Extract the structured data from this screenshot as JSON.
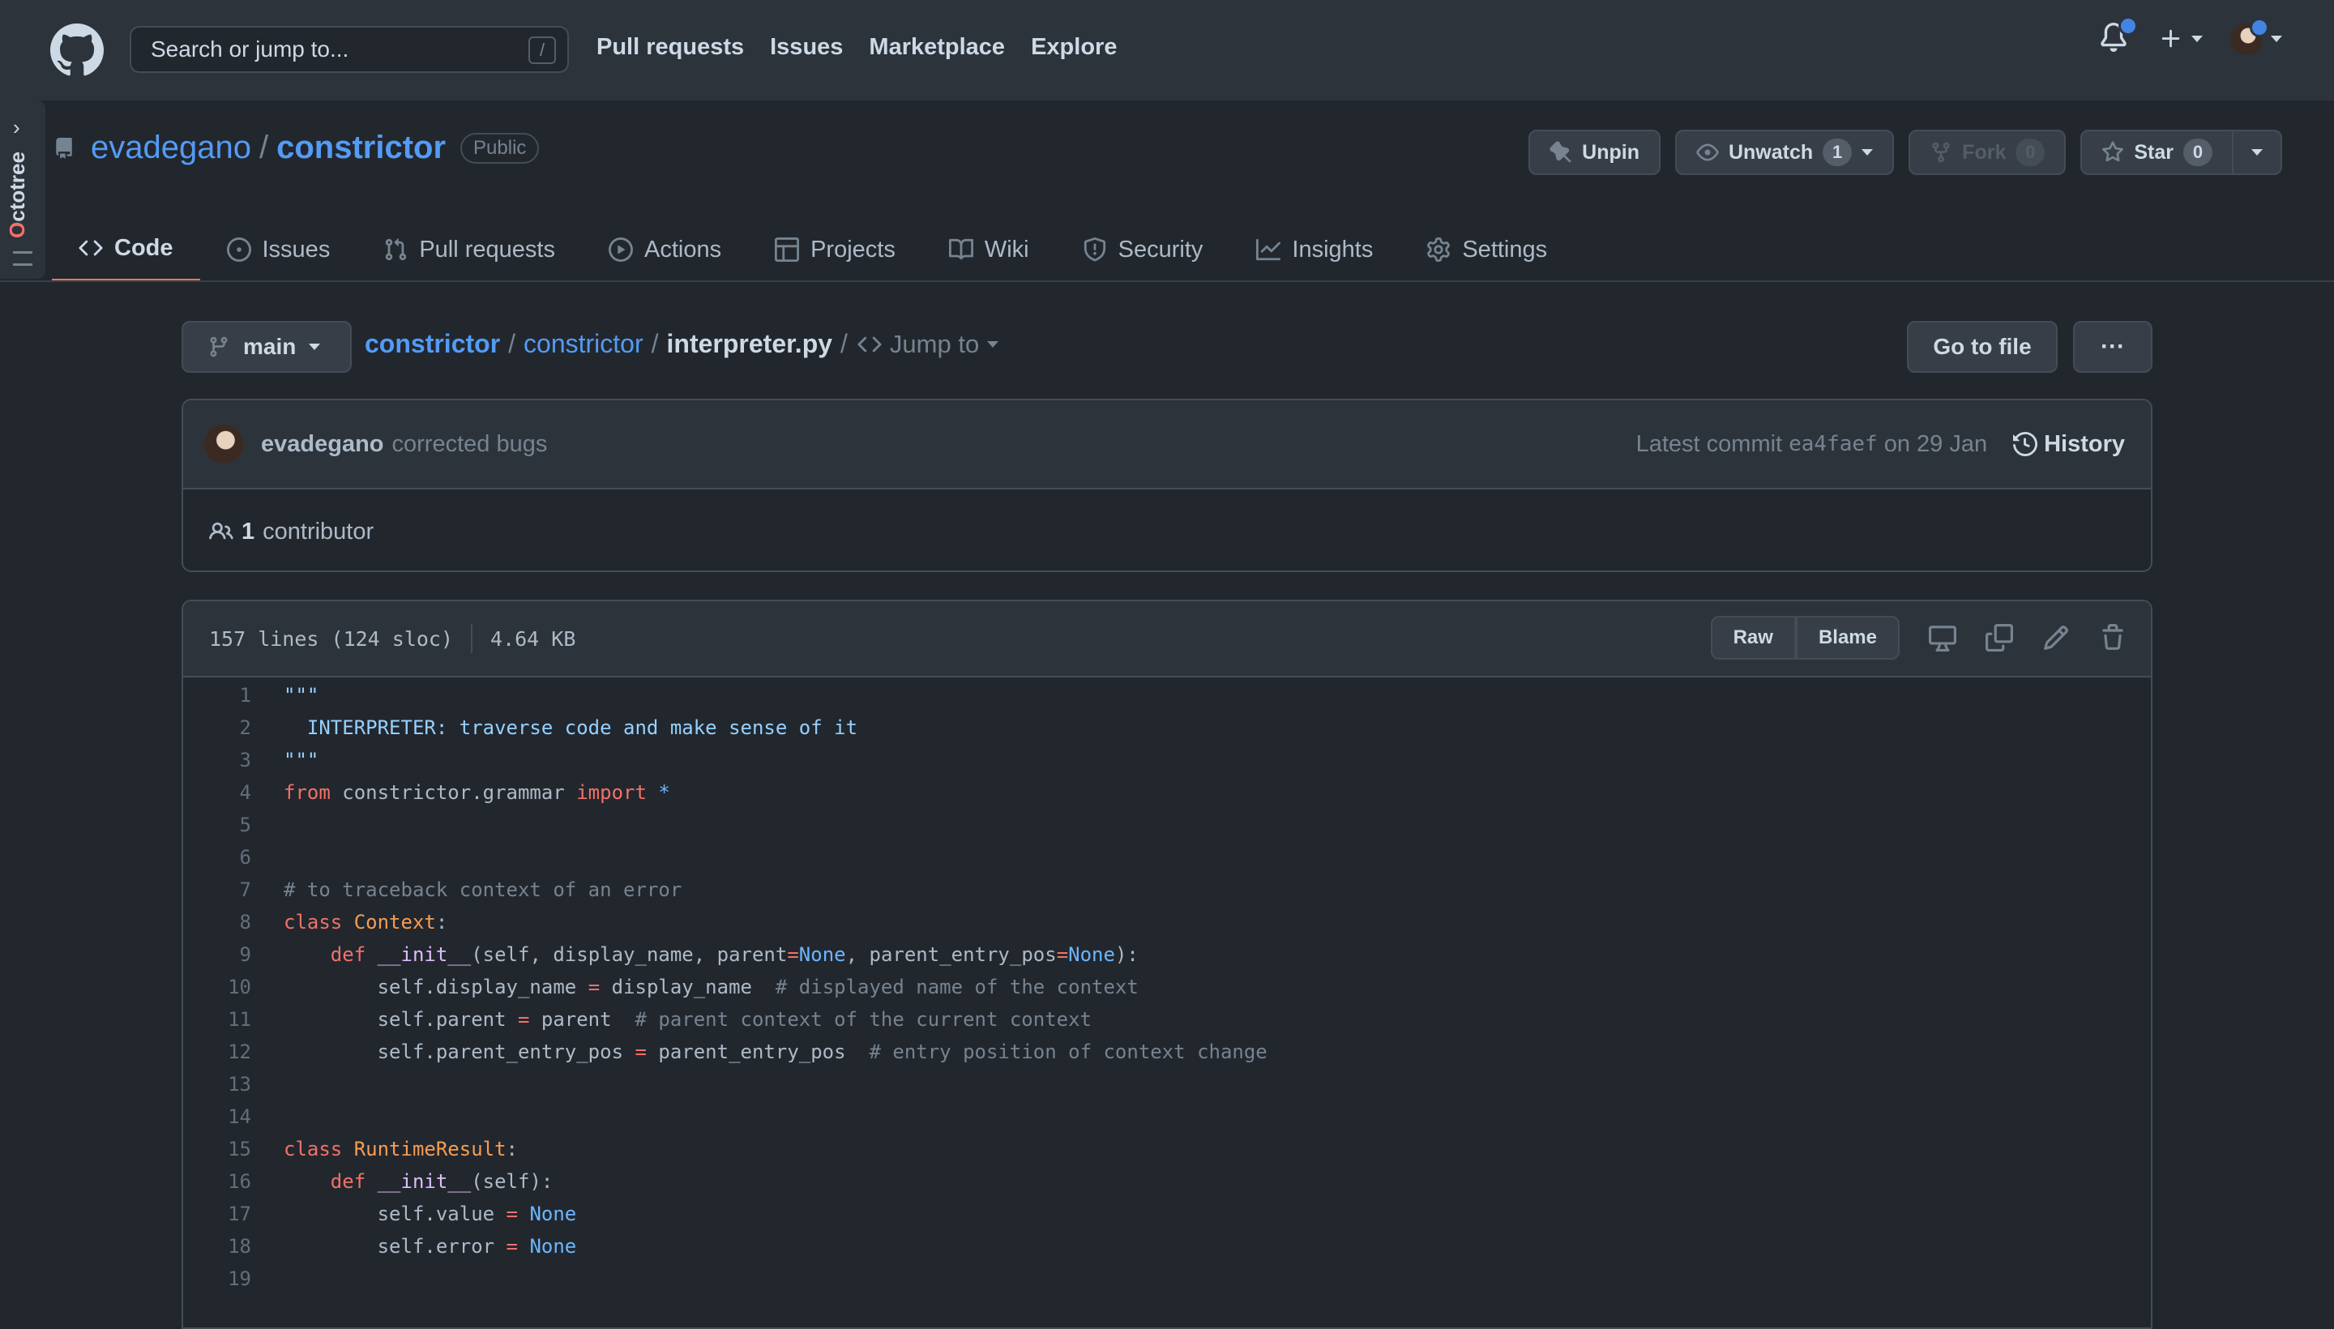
{
  "header": {
    "search_placeholder": "Search or jump to...",
    "search_shortcut": "/",
    "nav": [
      "Pull requests",
      "Issues",
      "Marketplace",
      "Explore"
    ]
  },
  "octotree": {
    "label_first": "O",
    "label_rest": "ctotree"
  },
  "repo": {
    "owner": "evadegano",
    "separator": "/",
    "name": "constrictor",
    "visibility": "Public",
    "unpin_label": "Unpin",
    "watch_label": "Unwatch",
    "watch_count": "1",
    "fork_label": "Fork",
    "fork_count": "0",
    "star_label": "Star",
    "star_count": "0"
  },
  "tabs": [
    {
      "label": "Code",
      "icon": "code-icon"
    },
    {
      "label": "Issues",
      "icon": "issue-icon"
    },
    {
      "label": "Pull requests",
      "icon": "pull-request-icon"
    },
    {
      "label": "Actions",
      "icon": "play-icon"
    },
    {
      "label": "Projects",
      "icon": "table-icon"
    },
    {
      "label": "Wiki",
      "icon": "book-icon"
    },
    {
      "label": "Security",
      "icon": "shield-icon"
    },
    {
      "label": "Insights",
      "icon": "graph-icon"
    },
    {
      "label": "Settings",
      "icon": "gear-icon"
    }
  ],
  "filenav": {
    "branch": "main",
    "crumb_root": "constrictor",
    "crumb_dir": "constrictor",
    "crumb_file": "interpreter.py",
    "crumb_sep": "/",
    "jump_label": "Jump to",
    "goto_label": "Go to file",
    "more_label": "···"
  },
  "commit": {
    "author": "evadegano",
    "message": "corrected bugs",
    "latest_label": "Latest commit",
    "sha": "ea4faef",
    "date": "on 29 Jan",
    "history_label": "History",
    "contributors_count": "1",
    "contributors_label": "contributor"
  },
  "file": {
    "lines_info": "157 lines (124 sloc)",
    "size": "4.64 KB",
    "raw_label": "Raw",
    "blame_label": "Blame"
  },
  "code_lines": [
    {
      "n": "1",
      "t": [
        [
          "str",
          "\"\"\""
        ]
      ]
    },
    {
      "n": "2",
      "t": [
        [
          "str",
          "  INTERPRETER: traverse code and make sense of it"
        ]
      ]
    },
    {
      "n": "3",
      "t": [
        [
          "str",
          "\"\"\""
        ]
      ]
    },
    {
      "n": "4",
      "t": [
        [
          "kw",
          "from"
        ],
        [
          "src",
          " constrictor.grammar "
        ],
        [
          "kw",
          "import"
        ],
        [
          "src",
          " "
        ],
        [
          "con",
          "*"
        ]
      ]
    },
    {
      "n": "5",
      "t": []
    },
    {
      "n": "6",
      "t": []
    },
    {
      "n": "7",
      "t": [
        [
          "cmt",
          "# to traceback context of an error"
        ]
      ]
    },
    {
      "n": "8",
      "t": [
        [
          "kw",
          "class"
        ],
        [
          "src",
          " "
        ],
        [
          "ent",
          "Context"
        ],
        [
          "src",
          ":"
        ]
      ]
    },
    {
      "n": "9",
      "t": [
        [
          "src",
          "    "
        ],
        [
          "kw",
          "def"
        ],
        [
          "src",
          " "
        ],
        [
          "fn",
          "__init__"
        ],
        [
          "src",
          "(self, display_name, parent"
        ],
        [
          "kw",
          "="
        ],
        [
          "con",
          "None"
        ],
        [
          "src",
          ", parent_entry_pos"
        ],
        [
          "kw",
          "="
        ],
        [
          "con",
          "None"
        ],
        [
          "src",
          "):"
        ]
      ]
    },
    {
      "n": "10",
      "t": [
        [
          "src",
          "        self.display_name "
        ],
        [
          "kw",
          "="
        ],
        [
          "src",
          " display_name  "
        ],
        [
          "cmt",
          "# displayed name of the context"
        ]
      ]
    },
    {
      "n": "11",
      "t": [
        [
          "src",
          "        self.parent "
        ],
        [
          "kw",
          "="
        ],
        [
          "src",
          " parent  "
        ],
        [
          "cmt",
          "# parent context of the current context"
        ]
      ]
    },
    {
      "n": "12",
      "t": [
        [
          "src",
          "        self.parent_entry_pos "
        ],
        [
          "kw",
          "="
        ],
        [
          "src",
          " parent_entry_pos  "
        ],
        [
          "cmt",
          "# entry position of context change"
        ]
      ]
    },
    {
      "n": "13",
      "t": []
    },
    {
      "n": "14",
      "t": []
    },
    {
      "n": "15",
      "t": [
        [
          "kw",
          "class"
        ],
        [
          "src",
          " "
        ],
        [
          "ent",
          "RuntimeResult"
        ],
        [
          "src",
          ":"
        ]
      ]
    },
    {
      "n": "16",
      "t": [
        [
          "src",
          "    "
        ],
        [
          "kw",
          "def"
        ],
        [
          "src",
          " "
        ],
        [
          "fn",
          "__init__"
        ],
        [
          "src",
          "(self):"
        ]
      ]
    },
    {
      "n": "17",
      "t": [
        [
          "src",
          "        self.value "
        ],
        [
          "kw",
          "="
        ],
        [
          "src",
          " "
        ],
        [
          "con",
          "None"
        ]
      ]
    },
    {
      "n": "18",
      "t": [
        [
          "src",
          "        self.error "
        ],
        [
          "kw",
          "="
        ],
        [
          "src",
          " "
        ],
        [
          "con",
          "None"
        ]
      ]
    },
    {
      "n": "19",
      "t": []
    }
  ]
}
